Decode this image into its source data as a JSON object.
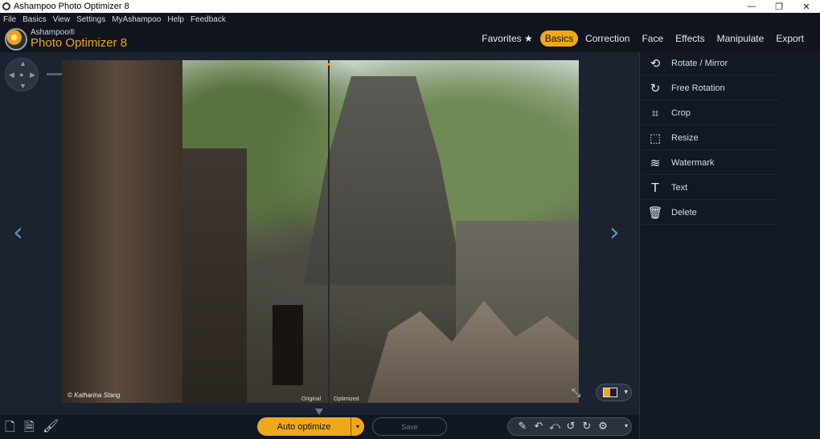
{
  "window": {
    "title": "Ashampoo Photo Optimizer 8",
    "controls": [
      "—",
      "❐",
      "✕"
    ]
  },
  "menu": [
    "File",
    "Basics",
    "View",
    "Settings",
    "MyAshampoo",
    "Help",
    "Feedback"
  ],
  "brand": {
    "top": "Ashampoo®",
    "name": "Photo Optimizer 8"
  },
  "tabs": [
    {
      "label": "Favorites ★"
    },
    {
      "label": "Basics",
      "active": true
    },
    {
      "label": "Correction"
    },
    {
      "label": "Face"
    },
    {
      "label": "Effects"
    },
    {
      "label": "Manipulate"
    },
    {
      "label": "Export"
    }
  ],
  "viewer": {
    "credit": "© Katharina Stang",
    "original_label": "Original",
    "optimized_label": "Optimized",
    "zoom_level": 0.38
  },
  "side_panel": {
    "items": [
      {
        "label": "Rotate / Mirror",
        "icon": "rotate-mirror-icon"
      },
      {
        "label": "Free Rotation",
        "icon": "free-rotation-icon"
      },
      {
        "label": "Crop",
        "icon": "crop-icon"
      },
      {
        "label": "Resize",
        "icon": "resize-icon"
      },
      {
        "label": "Watermark",
        "icon": "watermark-icon"
      },
      {
        "label": "Text",
        "icon": "text-icon"
      },
      {
        "label": "Delete",
        "icon": "delete-icon"
      }
    ]
  },
  "bottom": {
    "auto_optimize": "Auto optimize",
    "save": "Save"
  },
  "colors": {
    "accent": "#f0a81b",
    "panel": "#131923",
    "background": "#1b2230"
  }
}
